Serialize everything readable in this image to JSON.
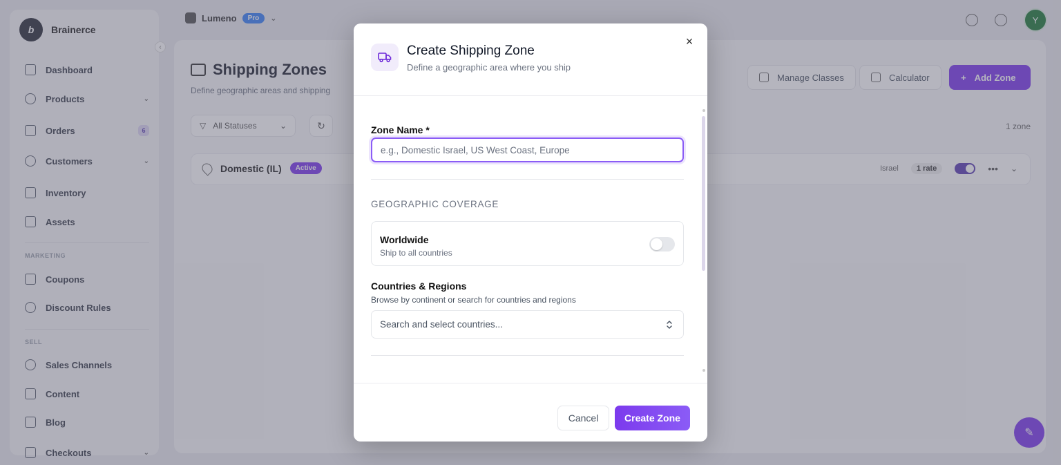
{
  "app": {
    "brand_name": "Brainerce",
    "store_name": "Lumeno",
    "plan_badge": "Pro",
    "user_initial": "Y"
  },
  "sidebar": {
    "items": [
      {
        "label": "Dashboard",
        "icon": "chart-icon"
      },
      {
        "label": "Products",
        "icon": "box-icon",
        "has_submenu": true
      },
      {
        "label": "Orders",
        "icon": "cart-icon",
        "badge": "6"
      },
      {
        "label": "Customers",
        "icon": "users-icon",
        "has_submenu": true
      },
      {
        "label": "Inventory",
        "icon": "inventory-icon"
      },
      {
        "label": "Assets",
        "icon": "image-icon"
      }
    ],
    "section_marketing": "MARKETING",
    "marketing_items": [
      {
        "label": "Coupons",
        "icon": "ticket-icon"
      },
      {
        "label": "Discount Rules",
        "icon": "percent-icon"
      }
    ],
    "section_sell": "SELL",
    "sell_items": [
      {
        "label": "Sales Channels",
        "icon": "globe-icon"
      },
      {
        "label": "Content",
        "icon": "file-icon"
      },
      {
        "label": "Blog",
        "icon": "book-icon"
      },
      {
        "label": "Checkouts",
        "icon": "checkout-icon",
        "has_submenu": true
      }
    ]
  },
  "page": {
    "title": "Shipping Zones",
    "subtitle": "Define geographic areas and shipping",
    "manage_classes": "Manage Classes",
    "calculator": "Calculator",
    "add_zone": "Add Zone",
    "status_filter": "All Statuses",
    "zone_count": "1 zone",
    "zones": [
      {
        "name": "Domestic (IL)",
        "status": "Active",
        "country": "Israel",
        "rates": "1 rate",
        "enabled": true
      }
    ]
  },
  "modal": {
    "title": "Create Shipping Zone",
    "subtitle": "Define a geographic area where you ship",
    "zone_name_label": "Zone Name *",
    "zone_name_placeholder": "e.g., Domestic Israel, US West Coast, Europe",
    "zone_name_value": "",
    "coverage_heading": "GEOGRAPHIC COVERAGE",
    "worldwide_title": "Worldwide",
    "worldwide_desc": "Ship to all countries",
    "worldwide_enabled": false,
    "countries_label": "Countries & Regions",
    "countries_desc": "Browse by continent or search for countries and regions",
    "countries_placeholder": "Search and select countries...",
    "cancel_label": "Cancel",
    "create_label": "Create Zone"
  },
  "colors": {
    "accent": "#7c3aed",
    "accent_soft": "#f1ecfb",
    "focus_ring": "#8b5cf6"
  }
}
